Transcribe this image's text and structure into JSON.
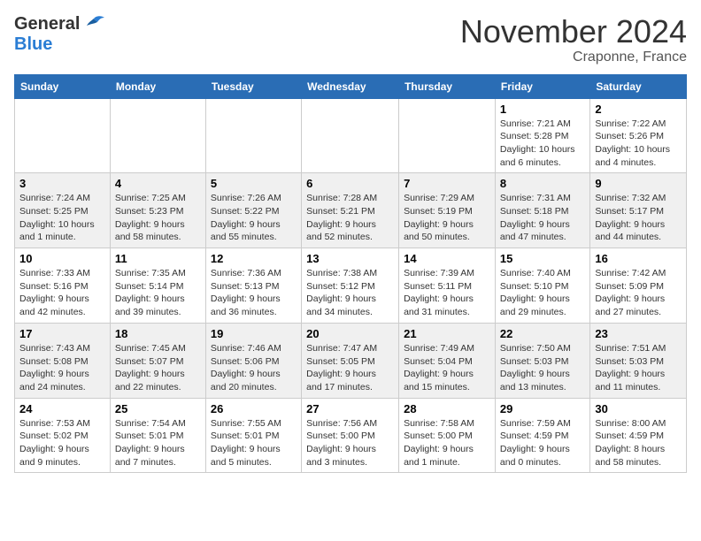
{
  "header": {
    "logo_general": "General",
    "logo_blue": "Blue",
    "title": "November 2024",
    "subtitle": "Craponne, France"
  },
  "weekdays": [
    "Sunday",
    "Monday",
    "Tuesday",
    "Wednesday",
    "Thursday",
    "Friday",
    "Saturday"
  ],
  "weeks": [
    {
      "days": [
        {
          "num": "",
          "info": ""
        },
        {
          "num": "",
          "info": ""
        },
        {
          "num": "",
          "info": ""
        },
        {
          "num": "",
          "info": ""
        },
        {
          "num": "",
          "info": ""
        },
        {
          "num": "1",
          "info": "Sunrise: 7:21 AM\nSunset: 5:28 PM\nDaylight: 10 hours\nand 6 minutes."
        },
        {
          "num": "2",
          "info": "Sunrise: 7:22 AM\nSunset: 5:26 PM\nDaylight: 10 hours\nand 4 minutes."
        }
      ]
    },
    {
      "days": [
        {
          "num": "3",
          "info": "Sunrise: 7:24 AM\nSunset: 5:25 PM\nDaylight: 10 hours\nand 1 minute."
        },
        {
          "num": "4",
          "info": "Sunrise: 7:25 AM\nSunset: 5:23 PM\nDaylight: 9 hours\nand 58 minutes."
        },
        {
          "num": "5",
          "info": "Sunrise: 7:26 AM\nSunset: 5:22 PM\nDaylight: 9 hours\nand 55 minutes."
        },
        {
          "num": "6",
          "info": "Sunrise: 7:28 AM\nSunset: 5:21 PM\nDaylight: 9 hours\nand 52 minutes."
        },
        {
          "num": "7",
          "info": "Sunrise: 7:29 AM\nSunset: 5:19 PM\nDaylight: 9 hours\nand 50 minutes."
        },
        {
          "num": "8",
          "info": "Sunrise: 7:31 AM\nSunset: 5:18 PM\nDaylight: 9 hours\nand 47 minutes."
        },
        {
          "num": "9",
          "info": "Sunrise: 7:32 AM\nSunset: 5:17 PM\nDaylight: 9 hours\nand 44 minutes."
        }
      ]
    },
    {
      "days": [
        {
          "num": "10",
          "info": "Sunrise: 7:33 AM\nSunset: 5:16 PM\nDaylight: 9 hours\nand 42 minutes."
        },
        {
          "num": "11",
          "info": "Sunrise: 7:35 AM\nSunset: 5:14 PM\nDaylight: 9 hours\nand 39 minutes."
        },
        {
          "num": "12",
          "info": "Sunrise: 7:36 AM\nSunset: 5:13 PM\nDaylight: 9 hours\nand 36 minutes."
        },
        {
          "num": "13",
          "info": "Sunrise: 7:38 AM\nSunset: 5:12 PM\nDaylight: 9 hours\nand 34 minutes."
        },
        {
          "num": "14",
          "info": "Sunrise: 7:39 AM\nSunset: 5:11 PM\nDaylight: 9 hours\nand 31 minutes."
        },
        {
          "num": "15",
          "info": "Sunrise: 7:40 AM\nSunset: 5:10 PM\nDaylight: 9 hours\nand 29 minutes."
        },
        {
          "num": "16",
          "info": "Sunrise: 7:42 AM\nSunset: 5:09 PM\nDaylight: 9 hours\nand 27 minutes."
        }
      ]
    },
    {
      "days": [
        {
          "num": "17",
          "info": "Sunrise: 7:43 AM\nSunset: 5:08 PM\nDaylight: 9 hours\nand 24 minutes."
        },
        {
          "num": "18",
          "info": "Sunrise: 7:45 AM\nSunset: 5:07 PM\nDaylight: 9 hours\nand 22 minutes."
        },
        {
          "num": "19",
          "info": "Sunrise: 7:46 AM\nSunset: 5:06 PM\nDaylight: 9 hours\nand 20 minutes."
        },
        {
          "num": "20",
          "info": "Sunrise: 7:47 AM\nSunset: 5:05 PM\nDaylight: 9 hours\nand 17 minutes."
        },
        {
          "num": "21",
          "info": "Sunrise: 7:49 AM\nSunset: 5:04 PM\nDaylight: 9 hours\nand 15 minutes."
        },
        {
          "num": "22",
          "info": "Sunrise: 7:50 AM\nSunset: 5:03 PM\nDaylight: 9 hours\nand 13 minutes."
        },
        {
          "num": "23",
          "info": "Sunrise: 7:51 AM\nSunset: 5:03 PM\nDaylight: 9 hours\nand 11 minutes."
        }
      ]
    },
    {
      "days": [
        {
          "num": "24",
          "info": "Sunrise: 7:53 AM\nSunset: 5:02 PM\nDaylight: 9 hours\nand 9 minutes."
        },
        {
          "num": "25",
          "info": "Sunrise: 7:54 AM\nSunset: 5:01 PM\nDaylight: 9 hours\nand 7 minutes."
        },
        {
          "num": "26",
          "info": "Sunrise: 7:55 AM\nSunset: 5:01 PM\nDaylight: 9 hours\nand 5 minutes."
        },
        {
          "num": "27",
          "info": "Sunrise: 7:56 AM\nSunset: 5:00 PM\nDaylight: 9 hours\nand 3 minutes."
        },
        {
          "num": "28",
          "info": "Sunrise: 7:58 AM\nSunset: 5:00 PM\nDaylight: 9 hours\nand 1 minute."
        },
        {
          "num": "29",
          "info": "Sunrise: 7:59 AM\nSunset: 4:59 PM\nDaylight: 9 hours\nand 0 minutes."
        },
        {
          "num": "30",
          "info": "Sunrise: 8:00 AM\nSunset: 4:59 PM\nDaylight: 8 hours\nand 58 minutes."
        }
      ]
    }
  ]
}
